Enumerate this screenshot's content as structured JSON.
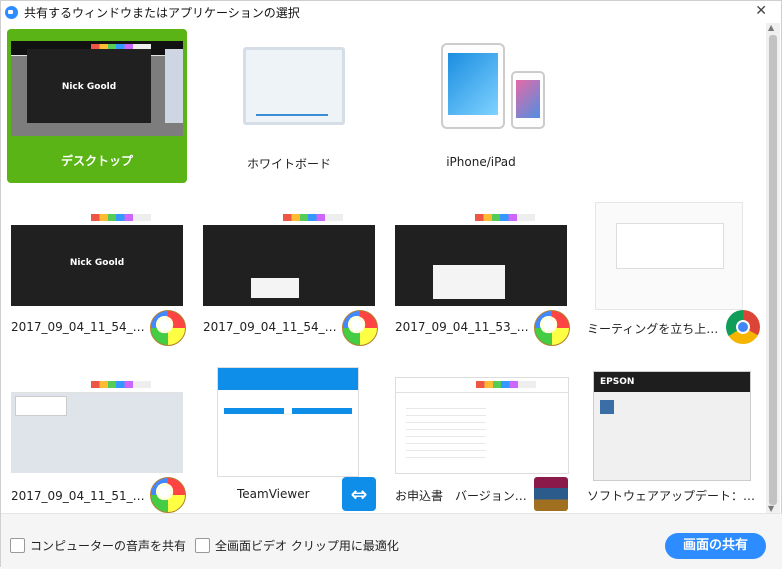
{
  "window": {
    "title": "共有するウィンドウまたはアプリケーションの選択",
    "close_glyph": "✕"
  },
  "top_tiles": [
    {
      "label": "デスクトップ",
      "preview_name": "Nick Goold",
      "selected": true
    },
    {
      "label": "ホワイトボード",
      "selected": false
    },
    {
      "label": "iPhone/iPad",
      "selected": false
    }
  ],
  "windows": [
    {
      "label": "2017_09_04_11_54_17_Zo...",
      "preview_name": "Nick Goold",
      "badge": "paint-icon"
    },
    {
      "label": "2017_09_04_11_54_05_20...",
      "badge": "paint-icon"
    },
    {
      "label": "2017_09_04_11_53_47_20...",
      "badge": "paint-icon"
    },
    {
      "label": "ミーティングを立ち上げる -...",
      "badge": "chrome-icon"
    },
    {
      "label": "2017_09_04_11_51_12_ミ...",
      "badge": "paint-icon"
    },
    {
      "label": "TeamViewer",
      "badge": "teamviewer-icon"
    },
    {
      "label": "お申込書　バージョンアッ...",
      "badge": "winrar-icon"
    },
    {
      "label": "ソフトウェアアップデート：E...",
      "preview_brand": "EPSON",
      "badge": null
    }
  ],
  "footer": {
    "share_audio": "コンピューターの音声を共有",
    "optimize_video": "全画面ビデオ クリップ用に最適化",
    "share_button": "画面の共有"
  },
  "colors": {
    "selected_tile": "#5ab415",
    "share_button": "#2d8cff"
  }
}
